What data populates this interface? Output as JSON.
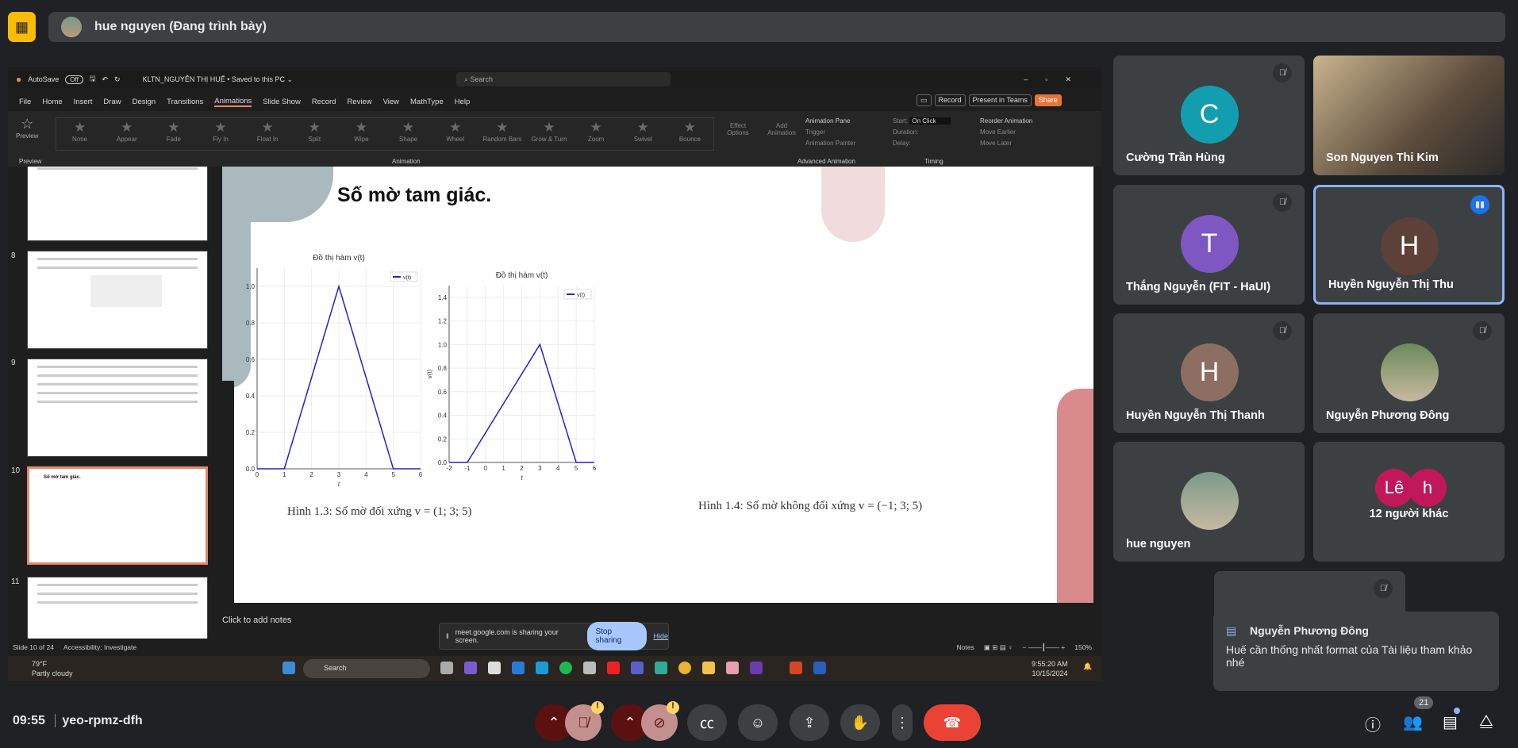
{
  "meet": {
    "presenter": "hue nguyen (Đang trình bày)",
    "time": "09:55",
    "meeting_code": "yeo-rpmz-dfh",
    "people_count": "21"
  },
  "ppt": {
    "autosave": "AutoSave",
    "autosave_state": "Off",
    "filename": "KLTN_NGUYỄN THỊ HUẾ • Saved to this PC ⌄",
    "search_placeholder": "Search",
    "menu": [
      "File",
      "Home",
      "Insert",
      "Draw",
      "Design",
      "Transitions",
      "Animations",
      "Slide Show",
      "Record",
      "Review",
      "View",
      "MathType",
      "Help"
    ],
    "active_menu": "Animations",
    "record": "Record",
    "present_teams": "Present in Teams",
    "share": "Share",
    "ribbon": {
      "preview": "Preview",
      "gallery": [
        "None",
        "Appear",
        "Fade",
        "Fly In",
        "Float In",
        "Split",
        "Wipe",
        "Shape",
        "Wheel",
        "Random Bars",
        "Grow & Turn",
        "Zoom",
        "Swivel",
        "Bounce"
      ],
      "effect_options": "Effect Options",
      "add_animation": "Add Animation",
      "animation_pane": "Animation Pane",
      "trigger": "Trigger",
      "animation_painter": "Animation Painter",
      "start": "Start:",
      "start_value": "On Click",
      "duration": "Duration:",
      "delay": "Delay:",
      "reorder": "Reorder Animation",
      "move_earlier": "Move Earlier",
      "move_later": "Move Later",
      "groups": [
        "Preview",
        "Animation",
        "Advanced Animation",
        "Timing"
      ]
    },
    "thumbnails": [
      "8",
      "9",
      "10",
      "11"
    ],
    "slide_title": "Số mờ tam giác.",
    "captions": [
      "Hình 1.3: Số mờ đối xứng v = (1; 3; 5)",
      "Hình 1.4: Số mờ không đối xứng v = (−1; 3; 5)"
    ],
    "notes": "Click to add notes",
    "status": {
      "slide": "Slide 10 of 24",
      "accessibility": "Accessibility: Investigate",
      "notes": "Notes",
      "zoom": "150%"
    },
    "share_banner": {
      "text": "meet.google.com is sharing your screen.",
      "stop": "Stop sharing",
      "hide": "Hide"
    },
    "taskbar": {
      "temp": "79°F",
      "weather": "Partly cloudy",
      "search": "Search",
      "clock": "9:55:20 AM",
      "date": "10/15/2024"
    }
  },
  "participants": [
    {
      "name": "Cường Trần Hùng",
      "initial": "C",
      "color": "#129eaf"
    },
    {
      "name": "Son Nguyen Thi Kim",
      "initial": "",
      "color": "#8a7a60"
    },
    {
      "name": "Thắng Nguyễn (FIT - HaUI)",
      "initial": "T",
      "color": "#7e57c2"
    },
    {
      "name": "Huyền Nguyễn Thị Thu",
      "initial": "H",
      "color": "#5d4037"
    },
    {
      "name": "Huyền Nguyễn Thị Thanh",
      "initial": "H",
      "color": "#8d6e63"
    },
    {
      "name": "Nguyễn Phương Đông",
      "initial": "",
      "color": "#6b8a5a"
    },
    {
      "name": "hue nguyen",
      "initial": "",
      "color": "#7a9a8a"
    },
    {
      "name": "12 người khác",
      "initial": "",
      "color": "#c2185b",
      "others": [
        "Lê",
        "h"
      ]
    }
  ],
  "toast": {
    "from": "Nguyễn Phương Đông",
    "message": "Huế cần thống nhất format của Tài liệu tham khảo nhé"
  },
  "chart_data": [
    {
      "type": "line",
      "title": "Đồ thị hàm v(t)",
      "xlabel": "t",
      "ylabel": "",
      "legend": "v(t)",
      "legend_position": "top-right",
      "grid": true,
      "color": "#2222cc",
      "x": [
        0,
        1,
        3,
        5,
        6
      ],
      "y": [
        0,
        0,
        1,
        0,
        0
      ],
      "xlim": [
        0,
        6
      ],
      "ylim": [
        0,
        1.1
      ],
      "xticks": [
        0,
        1,
        2,
        3,
        4,
        5,
        6
      ],
      "yticks": [
        0.0,
        0.2,
        0.4,
        0.6,
        0.8,
        1.0
      ]
    },
    {
      "type": "line",
      "title": "Đồ thị hàm v(t)",
      "xlabel": "t",
      "ylabel": "v(t)",
      "legend": "v(t)",
      "legend_position": "top-right",
      "grid": true,
      "color": "#2222cc",
      "x": [
        -2,
        -1,
        3,
        5,
        6
      ],
      "y": [
        0,
        0,
        1,
        0,
        0
      ],
      "xlim": [
        -2,
        6
      ],
      "ylim": [
        0,
        1.5
      ],
      "xticks": [
        -2,
        -1,
        0,
        1,
        2,
        3,
        4,
        5,
        6
      ],
      "yticks": [
        0.0,
        0.2,
        0.4,
        0.6,
        0.8,
        1.0,
        1.2,
        1.4
      ]
    }
  ]
}
